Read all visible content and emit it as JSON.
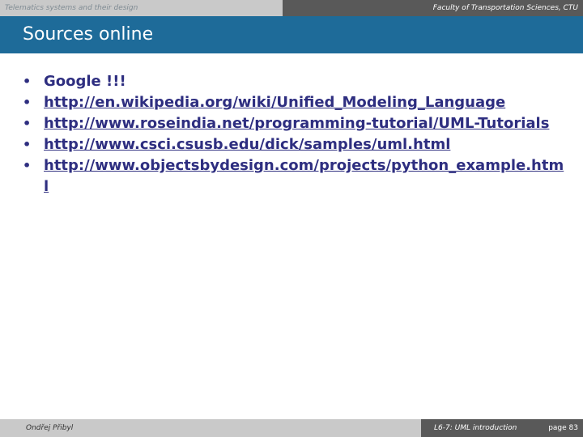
{
  "header": {
    "left": "Telematics systems and their design",
    "right": "Faculty of Transportation Sciences, CTU"
  },
  "slide": {
    "title": "Sources online",
    "items": [
      "Google !!!",
      "http://en.wikipedia.org/wiki/Unified_Modeling_Language",
      "http://www.roseindia.net/programming-tutorial/UML-Tutorials",
      "http://www.csci.csusb.edu/dick/samples/uml.html",
      "http://www.objectsbydesign.com/projects/python_example.html"
    ],
    "bullet": "•"
  },
  "footer": {
    "author": "Ondřej Přibyl",
    "lecture": "L6-7: UML introduction",
    "page": "page 83"
  }
}
